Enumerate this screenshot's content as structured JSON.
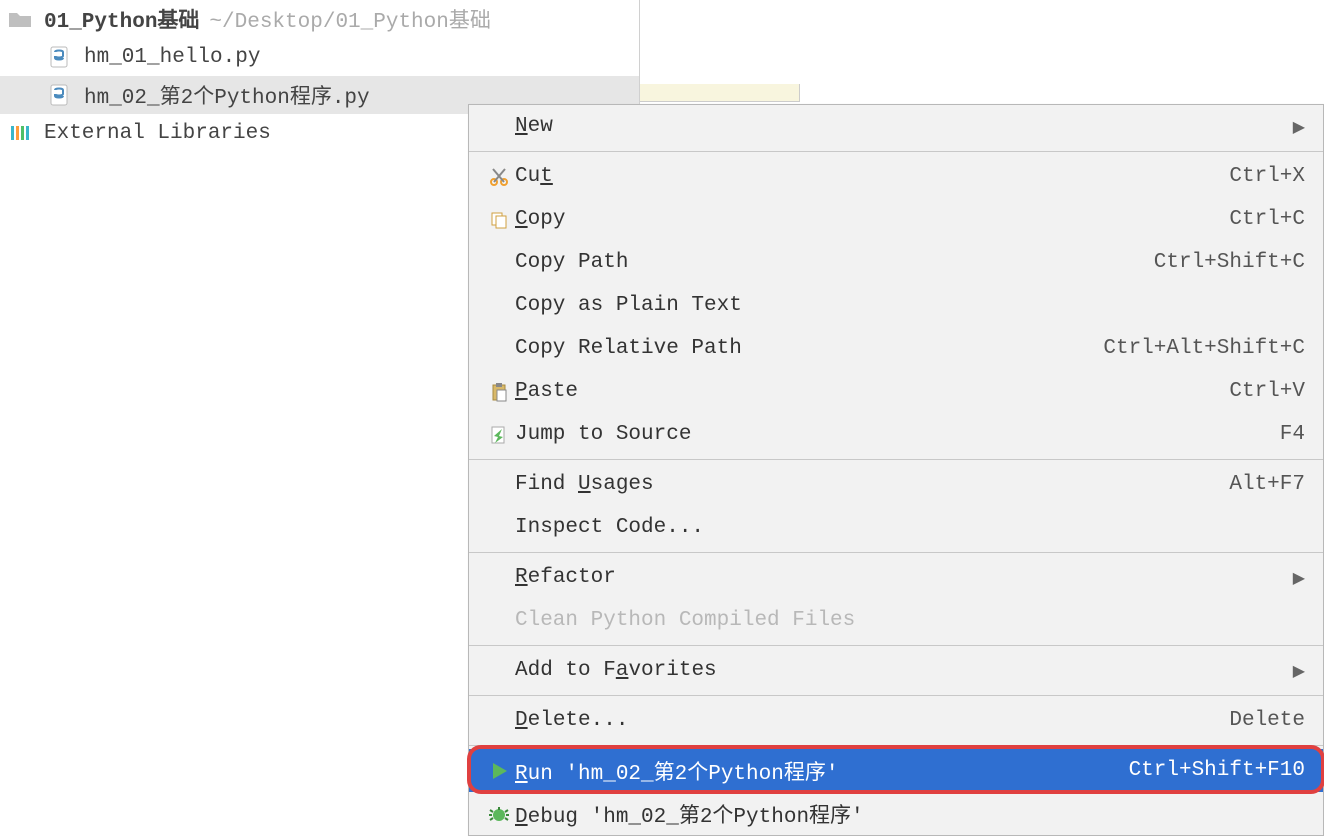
{
  "tree": {
    "root_name": "01_Python基础",
    "root_path": "~/Desktop/01_Python基础",
    "files": [
      {
        "name": "hm_01_hello.py"
      },
      {
        "name": "hm_02_第2个Python程序.py"
      }
    ],
    "external_libs": "External Libraries"
  },
  "menu": {
    "items": [
      {
        "id": "new",
        "label": "New",
        "u": "N",
        "shortcut": "",
        "icon": "",
        "submenu": true
      },
      {
        "sep": true
      },
      {
        "id": "cut",
        "label": "Cut",
        "u": "t",
        "shortcut": "Ctrl+X",
        "icon": "cut"
      },
      {
        "id": "copy",
        "label": "Copy",
        "u": "C",
        "shortcut": "Ctrl+C",
        "icon": "copy"
      },
      {
        "id": "copypath",
        "label": "Copy Path",
        "shortcut": "Ctrl+Shift+C",
        "icon": ""
      },
      {
        "id": "plaincopy",
        "label": "Copy as Plain Text",
        "shortcut": "",
        "icon": ""
      },
      {
        "id": "relpath",
        "label": "Copy Relative Path",
        "shortcut": "Ctrl+Alt+Shift+C",
        "icon": ""
      },
      {
        "id": "paste",
        "label": "Paste",
        "u": "P",
        "shortcut": "Ctrl+V",
        "icon": "paste"
      },
      {
        "id": "jump",
        "label": "Jump to Source",
        "shortcut": "F4",
        "icon": "jump"
      },
      {
        "sep": true
      },
      {
        "id": "usages",
        "label": "Find Usages",
        "u": "U",
        "shortcut": "Alt+F7",
        "icon": ""
      },
      {
        "id": "inspect",
        "label": "Inspect Code...",
        "shortcut": "",
        "icon": ""
      },
      {
        "sep": true
      },
      {
        "id": "refactor",
        "label": "Refactor",
        "u": "R",
        "shortcut": "",
        "icon": "",
        "submenu": true
      },
      {
        "id": "cleanpyc",
        "label": "Clean Python Compiled Files",
        "shortcut": "",
        "icon": "",
        "disabled": true
      },
      {
        "sep": true
      },
      {
        "id": "fav",
        "label": "Add to Favorites",
        "u": "a",
        "shortcut": "",
        "icon": "",
        "submenu": true
      },
      {
        "sep": true
      },
      {
        "id": "delete",
        "label": "Delete...",
        "u": "D",
        "shortcut": "Delete",
        "icon": ""
      },
      {
        "sep": true
      },
      {
        "id": "run",
        "label": "Run 'hm_02_第2个Python程序'",
        "u": "R",
        "shortcut": "Ctrl+Shift+F10",
        "icon": "run",
        "selected": true
      },
      {
        "id": "debug",
        "label": "Debug 'hm_02_第2个Python程序'",
        "u": "D",
        "shortcut": "",
        "icon": "bug"
      }
    ]
  },
  "colors": {
    "highlight": "#2f6fd1",
    "callout": "#e04040"
  }
}
